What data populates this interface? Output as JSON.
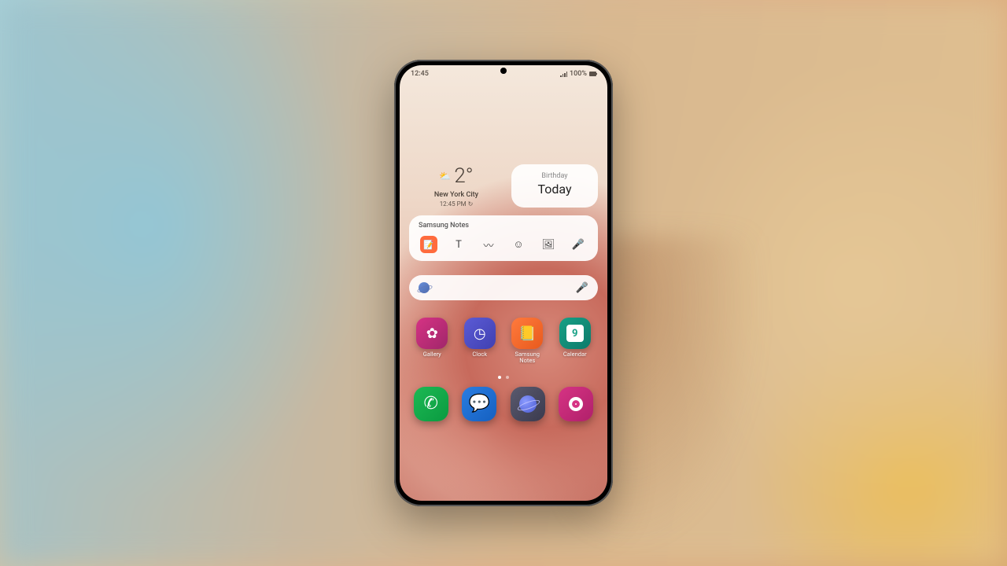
{
  "statusbar": {
    "time": "12:45",
    "battery_pct": "100%"
  },
  "weather": {
    "temperature": "2°",
    "city": "New York City",
    "updated": "12:45 PM ↻"
  },
  "calendar_widget": {
    "event": "Birthday",
    "when": "Today",
    "badge_day": "9"
  },
  "notes_widget": {
    "title": "Samsung Notes"
  },
  "apps": [
    {
      "label": "Gallery"
    },
    {
      "label": "Clock"
    },
    {
      "label": "Samsung\nNotes"
    },
    {
      "label": "Calendar"
    }
  ],
  "dock": [
    {
      "name": "Phone"
    },
    {
      "name": "Messages"
    },
    {
      "name": "Internet"
    },
    {
      "name": "Camera"
    }
  ]
}
